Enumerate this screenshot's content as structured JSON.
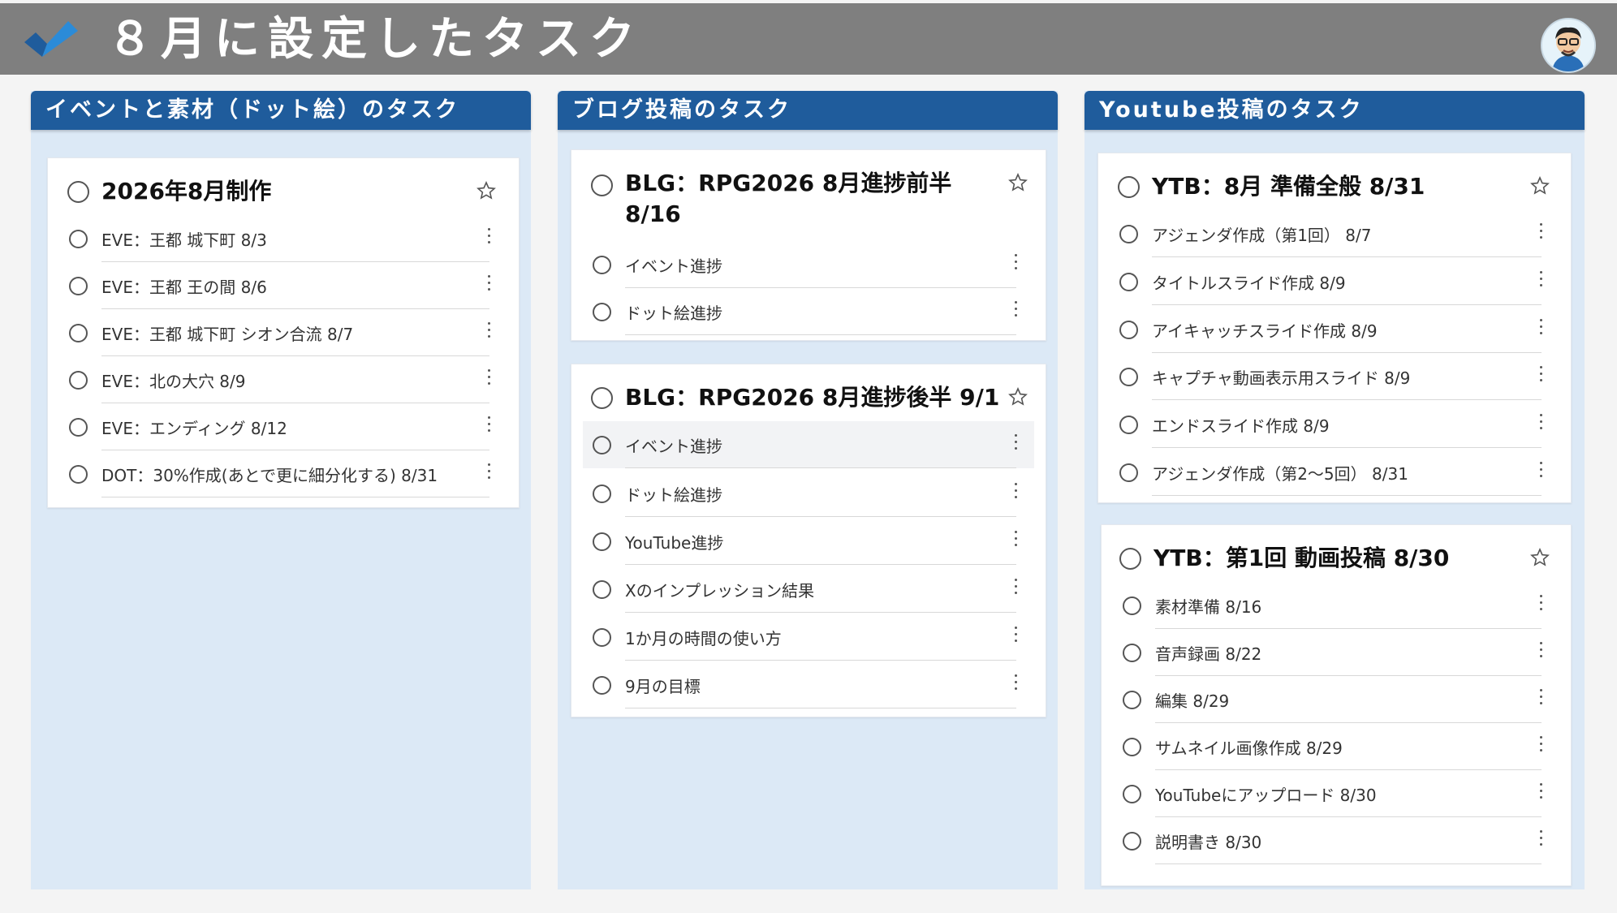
{
  "header": {
    "title": "８月に設定したタスク",
    "logo_icon": "checkmark-icon",
    "avatar_icon": "avatar",
    "bg_color": "#7f7f7f"
  },
  "accent_color": "#1f5c9c",
  "columns": [
    {
      "title": "イベントと素材（ドット絵）のタスク",
      "cards": [
        {
          "title": "2026年8月制作",
          "tasks": [
            "EVE：王都 城下町 8/3",
            "EVE：王都 王の間 8/6",
            "EVE：王都 城下町 シオン合流 8/7",
            "EVE：北の大穴 8/9",
            "EVE：エンディング 8/12",
            "DOT：30%作成(あとで更に細分化する) 8/31"
          ]
        }
      ]
    },
    {
      "title": "ブログ投稿のタスク",
      "cards": [
        {
          "title_line1": "BLG：RPG2026 8月進捗前半",
          "title_line2": "8/16",
          "tasks": [
            "イベント進捗",
            "ドット絵進捗"
          ]
        },
        {
          "title": "BLG：RPG2026 8月進捗後半 9/1",
          "tasks": [
            "イベント進捗",
            "ドット絵進捗",
            "YouTube進捗",
            "Xのインプレッション結果",
            "1か月の時間の使い方",
            "9月の目標"
          ]
        }
      ]
    },
    {
      "title": "Youtube投稿のタスク",
      "cards": [
        {
          "title": "YTB：8月 準備全般 8/31",
          "tasks": [
            "アジェンダ作成（第1回） 8/7",
            "タイトルスライド作成 8/9",
            "アイキャッチスライド作成 8/9",
            "キャプチャ動画表示用スライド 8/9",
            "エンドスライド作成 8/9",
            "アジェンダ作成（第2～5回） 8/31"
          ]
        },
        {
          "title": "YTB：第1回 動画投稿 8/30",
          "tasks": [
            "素材準備 8/16",
            "音声録画 8/22",
            "編集 8/29",
            "サムネイル画像作成 8/29",
            "YouTubeにアップロード 8/30",
            "説明書き 8/30"
          ]
        }
      ]
    }
  ]
}
